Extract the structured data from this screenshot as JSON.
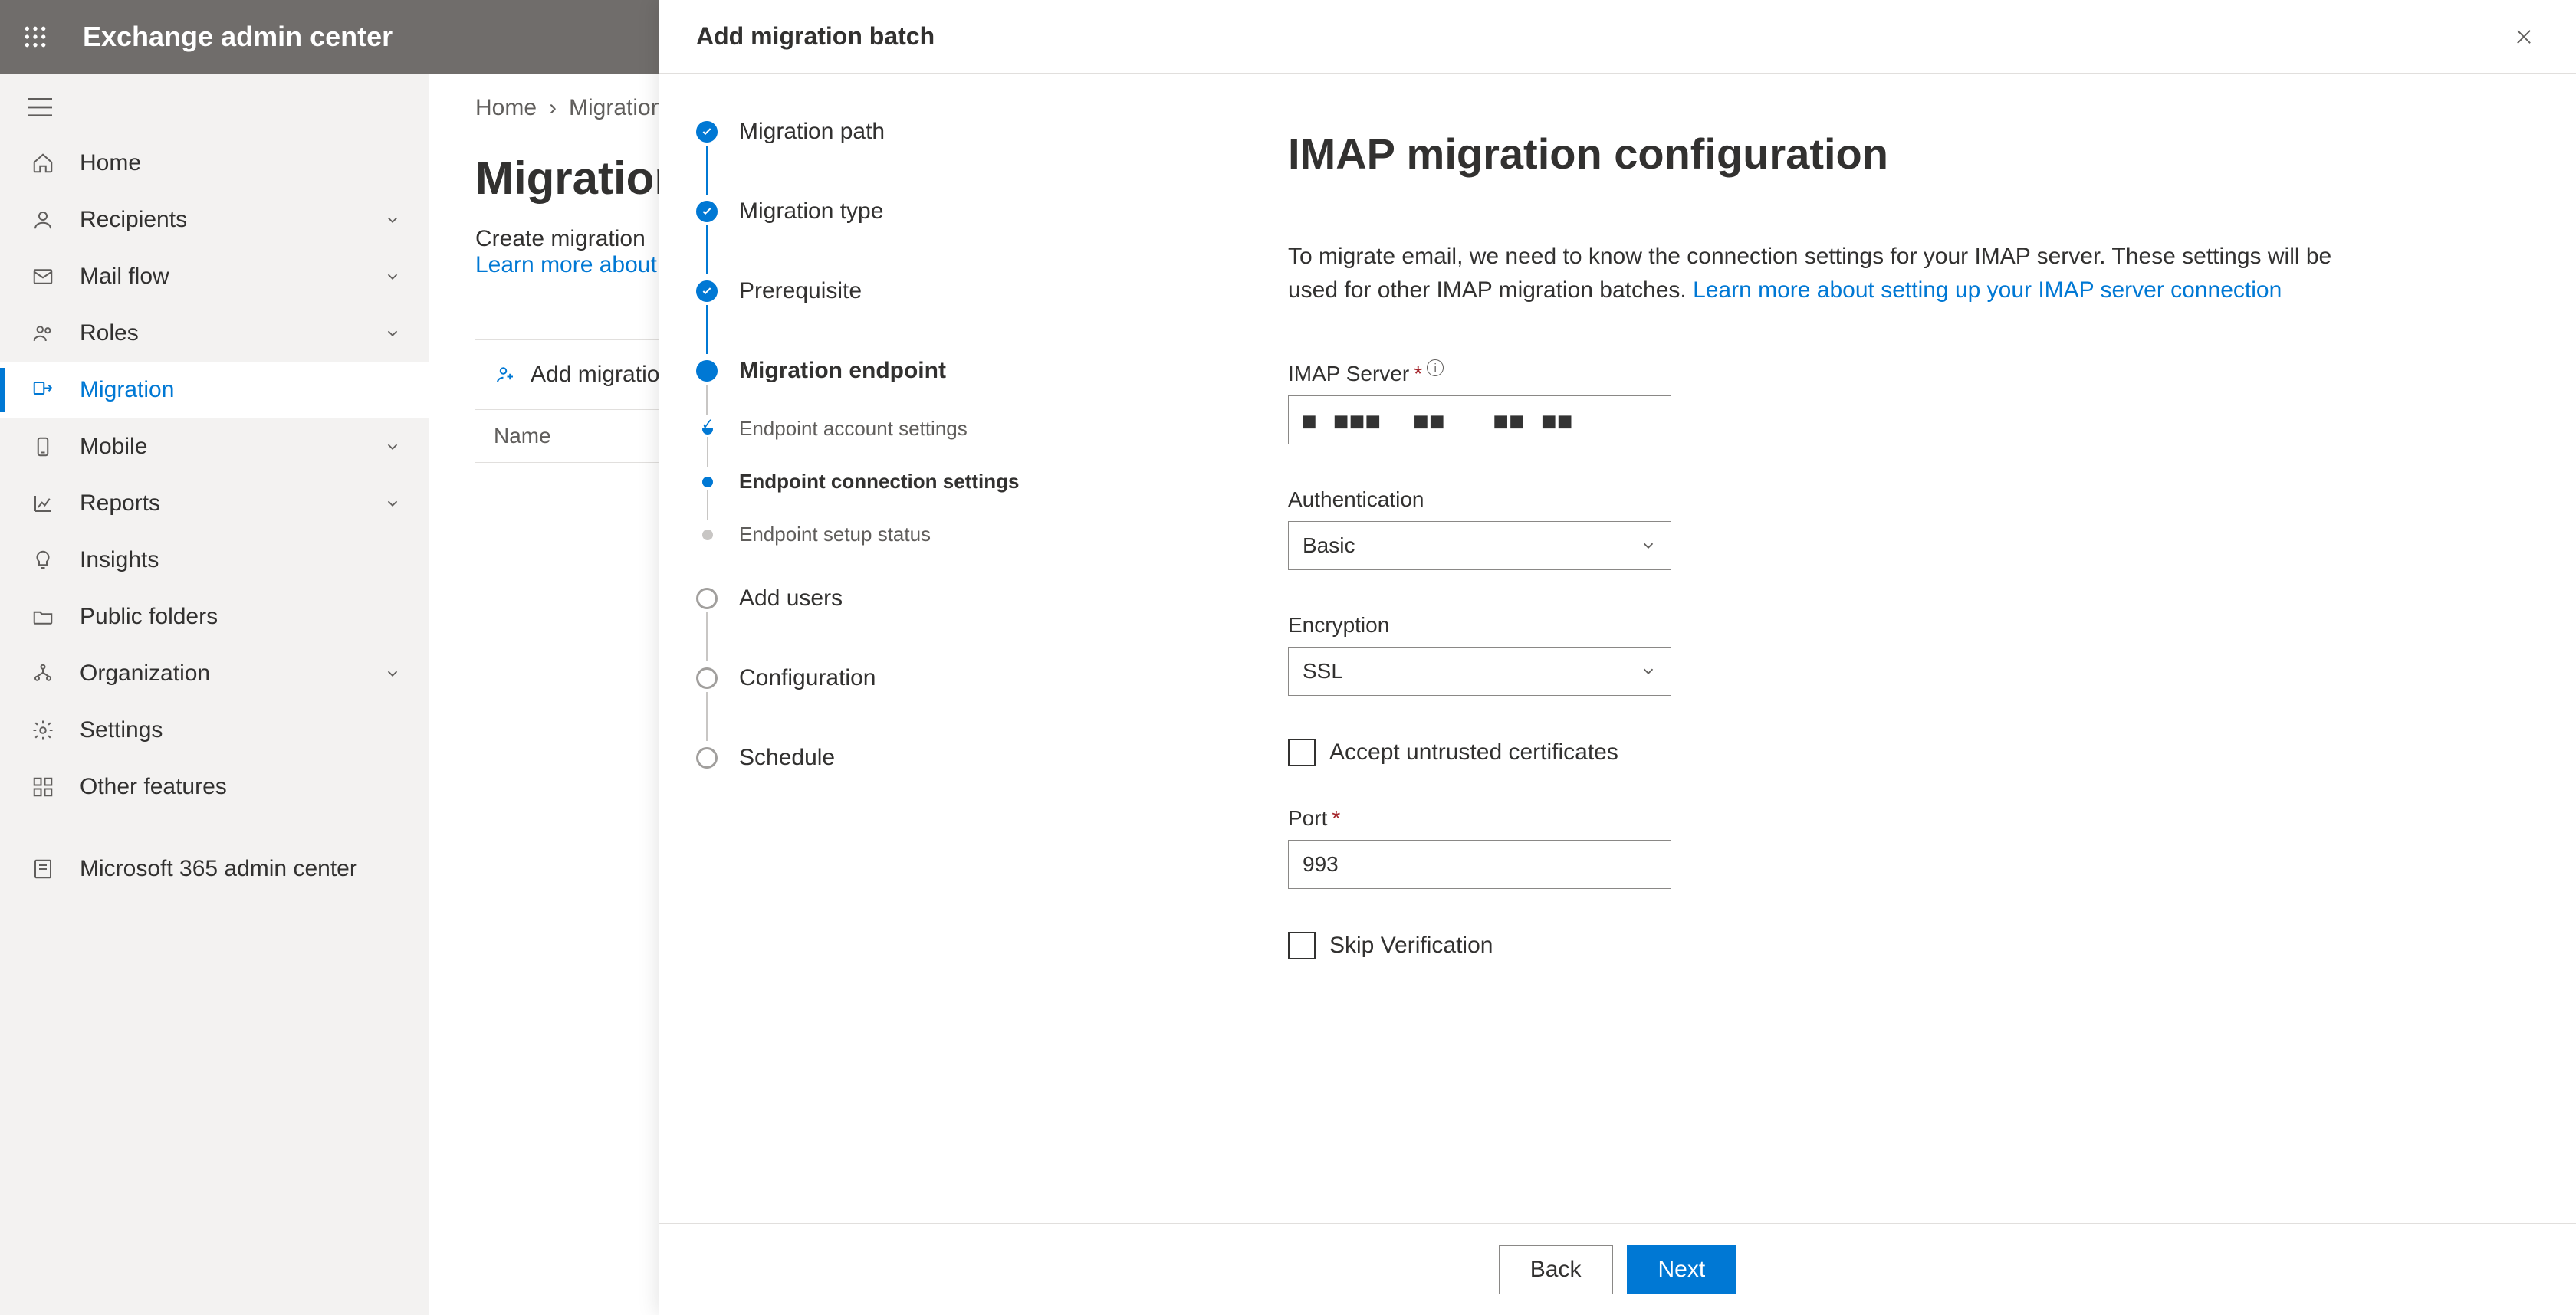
{
  "header": {
    "title": "Exchange admin center"
  },
  "nav": {
    "items": [
      {
        "label": "Home",
        "icon": "home-icon",
        "expandable": false
      },
      {
        "label": "Recipients",
        "icon": "person-icon",
        "expandable": true
      },
      {
        "label": "Mail flow",
        "icon": "mail-icon",
        "expandable": true
      },
      {
        "label": "Roles",
        "icon": "roles-icon",
        "expandable": true
      },
      {
        "label": "Migration",
        "icon": "migrate-icon",
        "expandable": false,
        "active": true
      },
      {
        "label": "Mobile",
        "icon": "mobile-icon",
        "expandable": true
      },
      {
        "label": "Reports",
        "icon": "chart-icon",
        "expandable": true
      },
      {
        "label": "Insights",
        "icon": "bulb-icon",
        "expandable": false
      },
      {
        "label": "Public folders",
        "icon": "folders-icon",
        "expandable": false
      },
      {
        "label": "Organization",
        "icon": "org-icon",
        "expandable": true
      },
      {
        "label": "Settings",
        "icon": "gear-icon",
        "expandable": false
      },
      {
        "label": "Other features",
        "icon": "grid-icon",
        "expandable": false
      }
    ],
    "footer": {
      "label": "Microsoft 365 admin center",
      "icon": "tenant-icon"
    }
  },
  "page": {
    "breadcrumb": [
      "Home",
      "Migration"
    ],
    "title": "Migration",
    "subtitle_prefix": "Create migration",
    "learn_more": "Learn more about",
    "add_button": "Add migration",
    "table": {
      "columns": [
        "Name"
      ]
    }
  },
  "panel": {
    "title": "Add migration batch",
    "steps": [
      {
        "label": "Migration path",
        "state": "done"
      },
      {
        "label": "Migration type",
        "state": "done"
      },
      {
        "label": "Prerequisite",
        "state": "done"
      },
      {
        "label": "Migration endpoint",
        "state": "current",
        "substeps": [
          {
            "label": "Endpoint account settings",
            "state": "done"
          },
          {
            "label": "Endpoint connection settings",
            "state": "current"
          },
          {
            "label": "Endpoint setup status",
            "state": "future"
          }
        ]
      },
      {
        "label": "Add users",
        "state": "future"
      },
      {
        "label": "Configuration",
        "state": "future"
      },
      {
        "label": "Schedule",
        "state": "future"
      }
    ],
    "form": {
      "title": "IMAP migration configuration",
      "description": "To migrate email, we need to know the connection settings for your IMAP server. These settings will be used for other IMAP migration batches.",
      "learn_more_text": "Learn more about setting up your IMAP server connection",
      "imap_server": {
        "label": "IMAP Server",
        "value": "■ ■■■  ■■   ■■ ■■"
      },
      "authentication": {
        "label": "Authentication",
        "value": "Basic"
      },
      "encryption": {
        "label": "Encryption",
        "value": "SSL"
      },
      "accept_untrusted": {
        "label": "Accept untrusted certificates",
        "checked": false
      },
      "port": {
        "label": "Port",
        "value": "993"
      },
      "skip_verification": {
        "label": "Skip Verification",
        "checked": false
      }
    },
    "footer": {
      "back": "Back",
      "next": "Next"
    }
  }
}
